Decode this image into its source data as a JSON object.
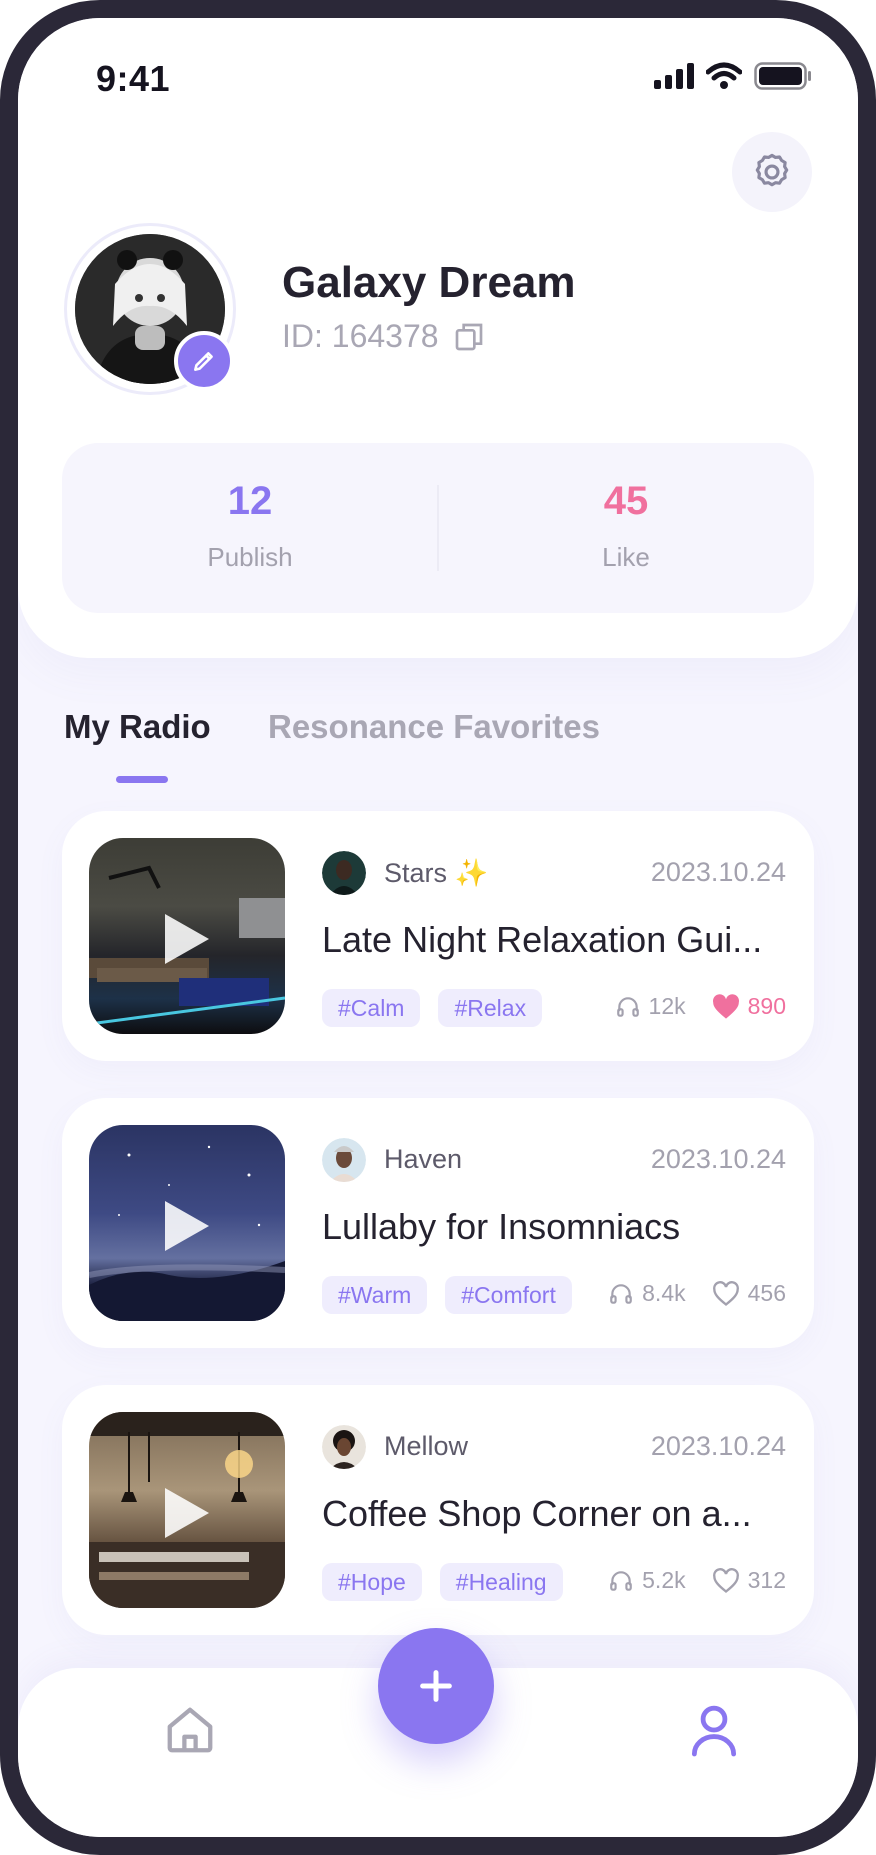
{
  "status": {
    "time": "9:41"
  },
  "profile": {
    "name": "Galaxy Dream",
    "id_text": "ID: 164378"
  },
  "stats": [
    {
      "value": "12",
      "label": "Publish",
      "color": "#8a76f0"
    },
    {
      "value": "45",
      "label": "Like",
      "color": "#f0709e"
    }
  ],
  "tabs": [
    {
      "label": "My Radio",
      "active": true
    },
    {
      "label": "Resonance Favorites",
      "active": false
    }
  ],
  "cards": [
    {
      "author": "Stars",
      "author_badge": "✨",
      "date": "2023.10.24",
      "title": "Late Night Relaxation Gui...",
      "tags": [
        "#Calm",
        "#Relax"
      ],
      "listens": "12k",
      "likes": "890",
      "liked": true
    },
    {
      "author": "Haven",
      "date": "2023.10.24",
      "title": "Lullaby for Insomniacs",
      "tags": [
        "#Warm",
        "#Comfort"
      ],
      "listens": "8.4k",
      "likes": "456",
      "liked": false
    },
    {
      "author": "Mellow",
      "date": "2023.10.24",
      "title": "Coffee Shop Corner on a...",
      "tags": [
        "#Hope",
        "#Healing"
      ],
      "listens": "5.2k",
      "likes": "312",
      "liked": false
    }
  ],
  "theme": {
    "accent": "#8a76f0",
    "like": "#f0709e"
  }
}
